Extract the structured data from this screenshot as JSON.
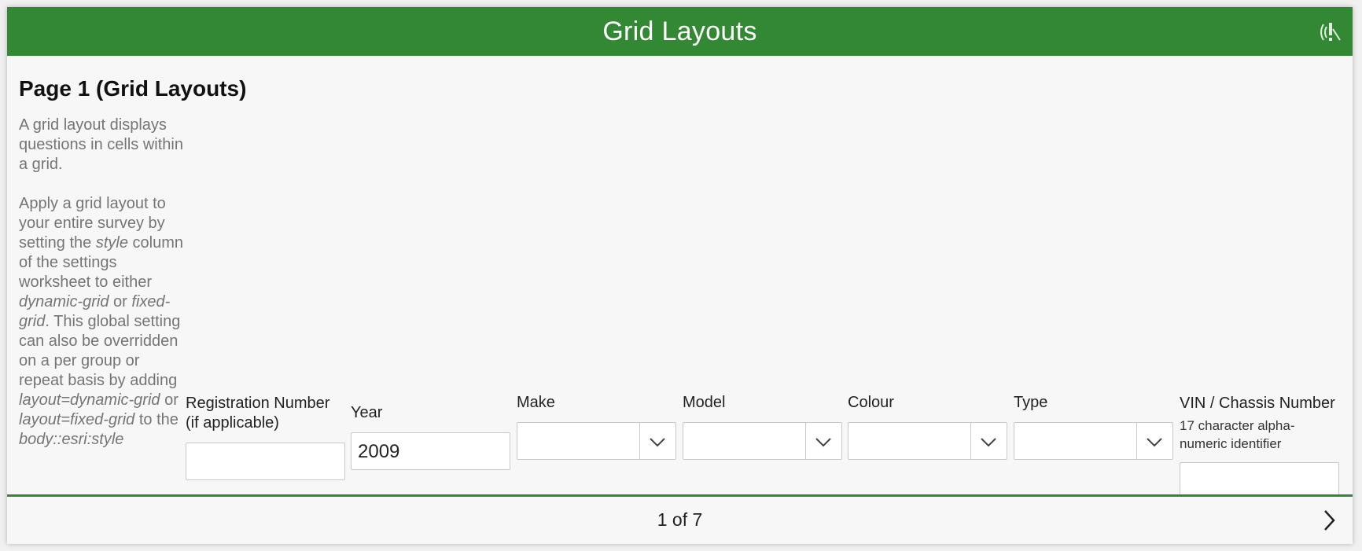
{
  "header": {
    "title": "Grid Layouts",
    "status_icon": "gps-warning-icon"
  },
  "page": {
    "title": "Page 1 (Grid Layouts)",
    "description": {
      "p1": "A grid layout displays questions in cells within a grid.",
      "p2_a": "Apply a grid layout to your entire survey by setting the ",
      "p2_style": "style",
      "p2_b": " column of the settings worksheet to either ",
      "p2_dynamic": "dynamic-grid",
      "p2_or": " or ",
      "p2_fixed": "fixed-grid",
      "p2_c": ". This global setting can also be overridden on a per group or repeat basis by adding ",
      "p2_layout_dynamic": "layout=dynamic-grid",
      "p2_or2": " or ",
      "p2_layout_fixed": "layout=fixed-grid",
      "p2_d": " to the ",
      "p2_body": "body::esri:style"
    }
  },
  "fields": {
    "registration": {
      "label": "Registration Number (if applicable)",
      "value": ""
    },
    "year": {
      "label": "Year",
      "value": "2009"
    },
    "make": {
      "label": "Make",
      "value": ""
    },
    "model": {
      "label": "Model",
      "value": ""
    },
    "colour": {
      "label": "Colour",
      "value": ""
    },
    "type": {
      "label": "Type",
      "value": ""
    },
    "vin": {
      "label": "VIN / Chassis Number",
      "hint": "17 character alpha-numeric identifier",
      "value": ""
    }
  },
  "footer": {
    "pager": "1 of 7",
    "next_icon": "chevron-right-icon"
  },
  "colors": {
    "accent": "#338833",
    "background": "#f7f7f7"
  }
}
